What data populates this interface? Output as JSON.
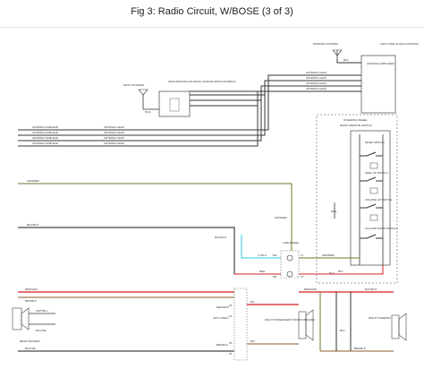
{
  "title": "Fig 3: Radio Circuit, W/BOSE (3 of 3)",
  "window_antenna": {
    "label": "WINDOW ANTENNA",
    "component": "(LEFT SIDE GLASS ANTENNA)",
    "amplifier": "ANTENNA AMPLIFIER",
    "ground": "BLK"
  },
  "roof_antenna": {
    "mast_label": "MAST ANTENNA",
    "module": "(NAVI MODULE OR ROOF) (GRAND) ROOF ANTENNA",
    "nca": "NCA"
  },
  "antenna_leads": [
    "ANTENNA LEAD",
    "ANTENNA LEAD",
    "ANTENNA LEAD",
    "ANTENNA LEAD"
  ],
  "sub_leads": [
    {
      "left": "ANTENNA SUBLEAD",
      "right": "ANTENNA LEAD"
    },
    {
      "left": "ANTENNA SUBLEAD",
      "right": "ANTENNA LEAD"
    },
    {
      "left": "ANTENNA SUBLEAD",
      "right": "ANTENNA LEAD"
    },
    {
      "left": "ANTENNA SUBLEAD",
      "right": "ANTENNA LEAD"
    }
  ],
  "steering": {
    "group": "STEERING WHEEL",
    "switch": "RADIO REMOTE SWITCH",
    "nca": "NCA",
    "switches": [
      "MODE SWITCH",
      "SEEK UP SWITCH",
      "VOLUME UP SWITCH",
      "VOLUME DOWN SWITCH"
    ],
    "ground": "BLK"
  },
  "wires": {
    "grn_red": "GRN/RED",
    "blk_wht": "BLK/WHT",
    "grn_red_2": "GRN/RED",
    "blk_wht_2": "BLK/WHT",
    "lt_blu": "LT BLU",
    "red": "RED",
    "grn_red_3": "GRN/RED",
    "blk": "BLK"
  },
  "cable_reel": {
    "label": "CABLE REEL",
    "pins": [
      "B12",
      "B11",
      "C7",
      "C7"
    ]
  },
  "speaker_section": {
    "left": {
      "wires": [
        "RED/GRN",
        "BRN/BLK",
        "BLK/YEL",
        "WHT/BLU",
        "BLK/YEL"
      ],
      "component": "REAR WOOFER"
    },
    "center": {
      "wires": [
        "RED/GRN",
        "(NOT USED)",
        "BRN/BLK"
      ],
      "pins": [
        "P4",
        "P3",
        "P6",
        "P5"
      ],
      "right_pins": [
        "B12",
        "B13"
      ],
      "component": "RIGHT PASSENGER'S DOOR SPEAKER"
    },
    "right": {
      "wires": [
        "RED/GRN",
        "BLK/WHT",
        "BRN/BLK",
        "BLK"
      ],
      "component": "RIGHT TWEETER"
    }
  }
}
